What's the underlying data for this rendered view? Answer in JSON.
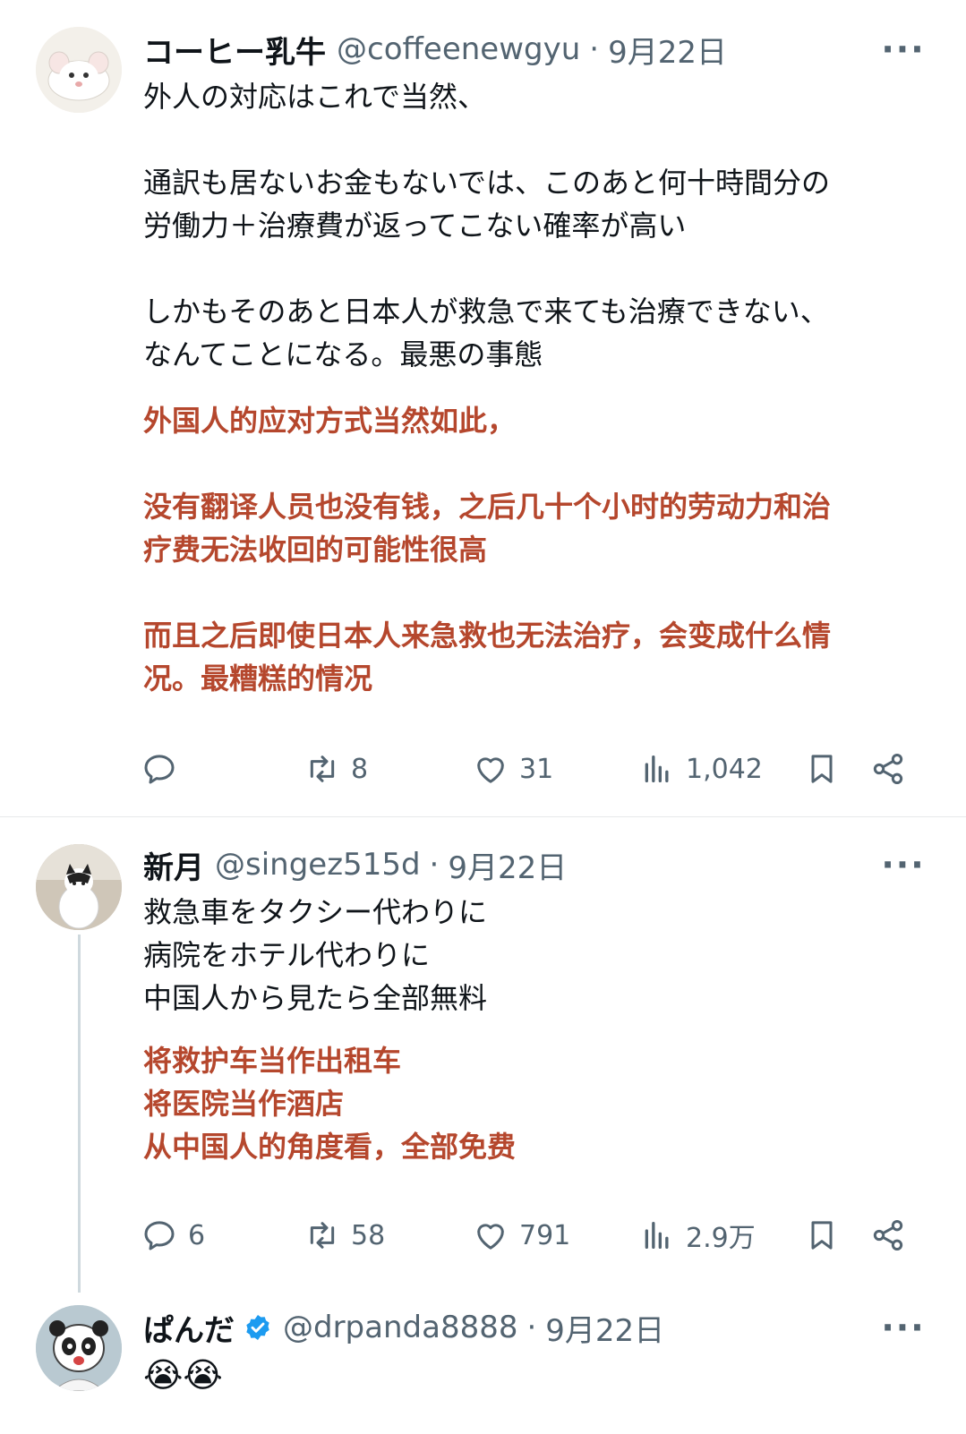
{
  "tweets": [
    {
      "name": "コーヒー乳牛",
      "handle": "@coffeenewgyu",
      "date": "9月22日",
      "more": "···",
      "jp_lines": [
        "外人の対応はこれで当然、",
        "",
        "通訳も居ないお金もないでは、このあと何十時間分の",
        "労働力＋治療費が返ってこない確率が高い",
        "",
        "しかもそのあと日本人が救急で来ても治療できない、",
        "なんてことになる。最悪の事態"
      ],
      "cn_lines": [
        "外国人的应对方式当然如此，",
        "",
        "没有翻译人员也没有钱，之后几十个小时的劳动力和治",
        "疗费无法收回的可能性很高",
        "",
        "而且之后即使日本人来急救也无法治疗，会变成什么情",
        "况。最糟糕的情况"
      ],
      "replies": "",
      "retweets": "8",
      "likes": "31",
      "views": "1,042",
      "avatar_icon": "white-rat-avatar"
    },
    {
      "name": "新月",
      "handle": "@singez515d",
      "date": "9月22日",
      "more": "···",
      "jp_lines": [
        "救急車をタクシー代わりに",
        "病院をホテル代わりに",
        "中国人から見たら全部無料"
      ],
      "cn_lines": [
        "将救护车当作出租车",
        "将医院当作酒店",
        "从中国人的角度看，全部免费"
      ],
      "replies": "6",
      "retweets": "58",
      "likes": "791",
      "views": "2.9万",
      "avatar_icon": "cat-avatar"
    },
    {
      "name": "ぱんだ",
      "handle": "@drpanda8888",
      "date": "9月22日",
      "more": "···",
      "emoji": "😭😭",
      "verified_icon": "verified-badge-icon",
      "avatar_icon": "panda-avatar"
    }
  ],
  "colors": {
    "text": "#0f1419",
    "secondary": "#536471",
    "translation": "#b5472d",
    "verified": "#1d9bf0",
    "divider": "#e7e9ea"
  }
}
